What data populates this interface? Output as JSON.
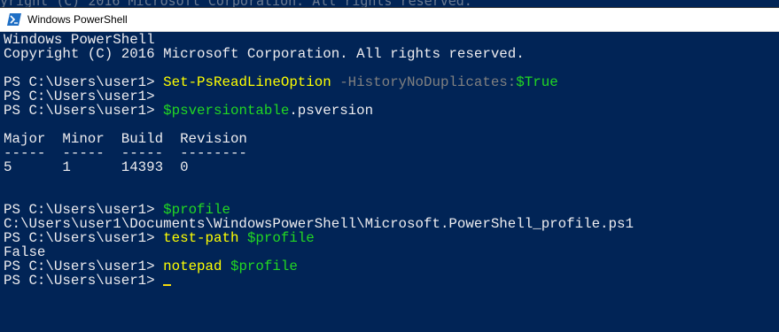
{
  "background_text": "yright (C) 2016 Microsoft Corporation. All rights reserved.",
  "window": {
    "title": "Windows PowerShell",
    "icon": "powershell-icon"
  },
  "colors": {
    "console_background": "#012456",
    "text": "#eeedf0",
    "command": "#ffff00",
    "parameter": "#808080",
    "variable": "#22d822",
    "cursor": "#f5d90b"
  },
  "console": {
    "line1": "Windows PowerShell",
    "line2": "Copyright (C) 2016 Microsoft Corporation. All rights reserved.",
    "line3": "",
    "line4": {
      "prompt": "PS C:\\Users\\user1> ",
      "command": "Set-PsReadLineOption",
      "param": " -HistoryNoDuplicates:",
      "value": "$True"
    },
    "line5": "PS C:\\Users\\user1>",
    "line6": {
      "prompt": "PS C:\\Users\\user1> ",
      "variable": "$psversiontable",
      "rest": ".psversion"
    },
    "line7": "",
    "line8": "Major  Minor  Build  Revision",
    "line9": "-----  -----  -----  --------",
    "line10": "5      1      14393  0",
    "line11": "",
    "line12": "",
    "line13": {
      "prompt": "PS C:\\Users\\user1> ",
      "variable": "$profile"
    },
    "line14": "C:\\Users\\user1\\Documents\\WindowsPowerShell\\Microsoft.PowerShell_profile.ps1",
    "line15": {
      "prompt": "PS C:\\Users\\user1> ",
      "command": "test-path",
      "space": " ",
      "variable": "$profile"
    },
    "line16": "False",
    "line17": {
      "prompt": "PS C:\\Users\\user1> ",
      "command": "notepad",
      "space": " ",
      "variable": "$profile"
    },
    "line18": {
      "prompt": "PS C:\\Users\\user1> "
    }
  }
}
